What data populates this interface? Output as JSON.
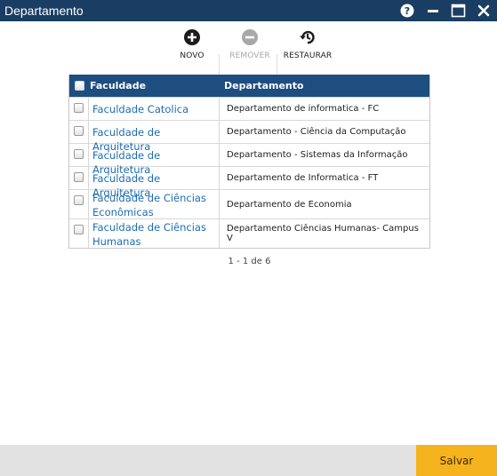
{
  "window": {
    "title": "Departamento"
  },
  "toolbar": {
    "novo_label": "NOVO",
    "remover_label": "REMOVER",
    "restaurar_label": "RESTAURAR"
  },
  "grid": {
    "columns": [
      "Faculdade",
      "Departamento"
    ],
    "rows": [
      {
        "faculdade": "Faculdade Catolica",
        "departamento": "Departamento de informatica - FC"
      },
      {
        "faculdade": "Faculdade de Arquitetura",
        "departamento": "Departamento - Ciência da Computação"
      },
      {
        "faculdade": "Faculdade de Arquitetura",
        "departamento": "Departamento - Sistemas da Informação"
      },
      {
        "faculdade": "Faculdade de Arquitetura",
        "departamento": "Departamento de Informatica - FT"
      },
      {
        "faculdade": "Faculdade de Ciências Econômicas",
        "departamento": "Departamento de Economia"
      },
      {
        "faculdade": "Faculdade de Ciências Humanas",
        "departamento": "Departamento Ciências Humanas- Campus V"
      }
    ]
  },
  "pager": {
    "text": "1 - 1 de 6"
  },
  "footer": {
    "save_label": "Salvar"
  },
  "colors": {
    "titlebar": "#1a3d63",
    "grid_header": "#1e4d80",
    "link": "#1d6db0",
    "save_button": "#f5b41d",
    "footer": "#e2e2e2"
  },
  "icons": [
    "help-icon",
    "minimize-icon",
    "maximize-icon",
    "close-icon",
    "plus-circle-icon",
    "minus-circle-icon",
    "restore-history-icon"
  ]
}
